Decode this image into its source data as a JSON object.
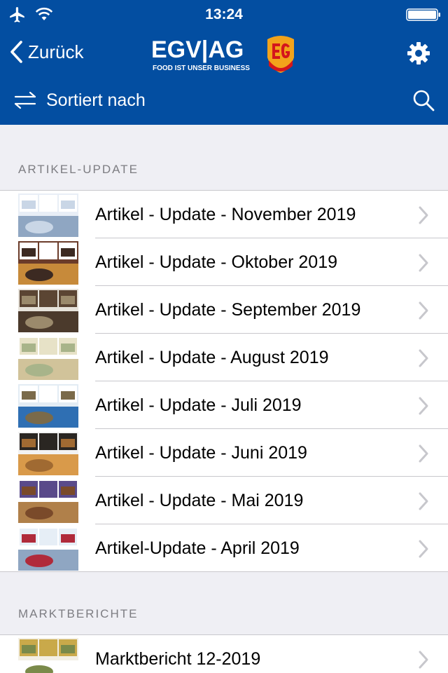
{
  "status_bar": {
    "time": "13:24"
  },
  "nav": {
    "back_label": "Zurück",
    "logo_text": "EGV|AG",
    "logo_tagline": "FOOD IST UNSER BUSINESS"
  },
  "toolbar": {
    "sort_label": "Sortiert nach"
  },
  "sections": [
    {
      "title": "ARTIKEL-UPDATE",
      "items": [
        {
          "label": "Artikel - Update - November 2019"
        },
        {
          "label": "Artikel - Update - Oktober 2019"
        },
        {
          "label": "Artikel - Update - September 2019"
        },
        {
          "label": "Artikel - Update - August 2019"
        },
        {
          "label": "Artikel - Update - Juli 2019"
        },
        {
          "label": "Artikel - Update - Juni 2019"
        },
        {
          "label": "Artikel - Update - Mai 2019"
        },
        {
          "label": "Artikel-Update - April 2019"
        }
      ]
    },
    {
      "title": "MARKTBERICHTE",
      "items": [
        {
          "label": "Marktbericht 12-2019"
        }
      ]
    }
  ],
  "colors": {
    "brand_blue": "#034ea1",
    "separator": "#c8c7cc",
    "chevron": "#c7c7cc",
    "section_text": "#7d7d82"
  }
}
